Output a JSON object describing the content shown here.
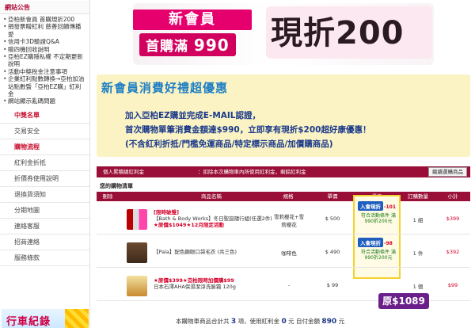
{
  "sidebar": {
    "news_header": "網站公告",
    "news": [
      "亞柏新會員 首購現折200",
      "捐發票贈紅利 慈善回饋傳播愛",
      "信用卡3D驗證Q&A",
      "贈四機回收說明",
      "亞柏EZ購隱私權 不定期更新說明",
      "活動中獎稅金注意事項",
      "企業紅利點數轉換→亞柏加油站點數暨「亞柏EZ購」紅利金",
      "網站顯示亂碼問題"
    ],
    "items": [
      {
        "label": "中獎名單",
        "hot": true
      },
      {
        "label": "交易安全",
        "hot": false
      },
      {
        "label": "購物流程",
        "hot": true
      },
      {
        "label": "紅利金折抵",
        "hot": false
      },
      {
        "label": "折價券使用說明",
        "hot": false
      },
      {
        "label": "退換貨須知",
        "hot": false
      },
      {
        "label": "分期地圖",
        "hot": false
      },
      {
        "label": "連絡客服",
        "hot": false
      },
      {
        "label": "招商連絡",
        "hot": false
      },
      {
        "label": "服務條款",
        "hot": false
      }
    ],
    "ad_text": "行車紀錄"
  },
  "banner": {
    "new_member": "新會員",
    "first_buy": "首購滿",
    "first_buy_amount": "990",
    "discount": "現折200"
  },
  "promo": {
    "title": "新會員消費好禮超優惠",
    "line1": "加入亞柏EZ購並完成E-MAIL認證，",
    "line2": "首次購物單筆消費金額達$990，立即享有現折$200超好康優惠！",
    "line3": "(不含紅利折抵/門檻免運商品/特定標示商品/加價購商品)"
  },
  "cart": {
    "bar_label1": "個人累積總紅利金",
    "bar_label2": "：扣除本次購物車內所使用紅利金，剩餘紅利金",
    "promo_button": "繼續選購商品",
    "title": "您的購物清單",
    "headers": [
      "刪除",
      "商品名稱",
      "規格",
      "單價",
      "優惠",
      "訂購數量",
      "小計"
    ],
    "rows": [
      {
        "name_line1": "[限時破盤]",
        "name_line1b": "【Bath & Body Works】冬日聖誕隨行組(任選2件)",
        "name_line2": "★原價$1049★12月限定活動",
        "spec": "雪莉櫻花+雪莉櫻花",
        "price": "$ 500",
        "qty": "1 組",
        "subtotal": "$399",
        "coupon_btn": "入會現折",
        "coupon_minus": "-101",
        "coupon_cond": "符合活動條件 滿990折200元"
      },
      {
        "name_line1": "",
        "name_line1b": "【Pala】配色顯眼口袋毛衣 (共三色)",
        "name_line2": "",
        "spec": "咖啡色",
        "price": "$ 490",
        "qty": "1 件",
        "subtotal": "$392",
        "coupon_btn": "入會現折",
        "coupon_minus": "-98",
        "coupon_cond": "符合活動條件 滿990折200元"
      },
      {
        "name_line1": "",
        "name_line1b": "★原價$399★亞柏限時加價購$99",
        "name_line2": "日本石澤AHA保濕潔淨洗臉霜 120g",
        "spec": "-",
        "price": "$ 99",
        "qty": "1 個",
        "subtotal": "$99",
        "coupon_btn": "",
        "coupon_minus": "",
        "coupon_cond": ""
      }
    ],
    "original_price": "原$1089",
    "summary_prefix": "本購物車商品合計共",
    "summary_count": "3",
    "summary_mid": "項，使用紅利金",
    "summary_bonus": "0",
    "summary_unit": "元",
    "summary_pay_label": "自付金額",
    "summary_pay": "890",
    "summary_pay_unit": "元"
  }
}
